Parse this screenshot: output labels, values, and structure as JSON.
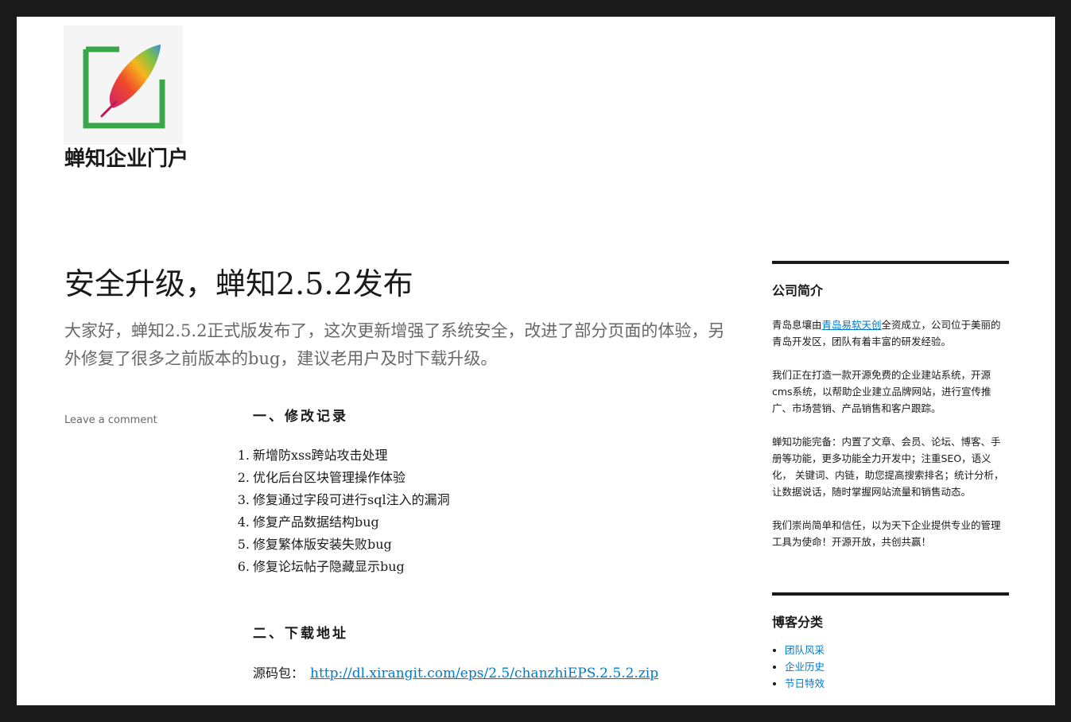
{
  "site": {
    "title": "蝉知企业门户",
    "logo_icon": "feather-logo-icon"
  },
  "post": {
    "title": "安全升级，蝉知2.5.2发布",
    "excerpt": "大家好，蝉知2.5.2正式版发布了，这次更新增强了系统安全，改进了部分页面的体验，另外修复了很多之前版本的bug，建议老用户及时下载升级。",
    "comment_link": "Leave a comment",
    "section1_heading": "一、修改记录",
    "changes": [
      {
        "num": "1.",
        "text": "新增防xss跨站攻击处理"
      },
      {
        "num": "2.",
        "text": "优化后台区块管理操作体验"
      },
      {
        "num": "3.",
        "text": "修复通过字段可进行sql注入的漏洞"
      },
      {
        "num": "4.",
        "text": "修复产品数据结构bug"
      },
      {
        "num": "5.",
        "text": "修复繁体版安装失败bug"
      },
      {
        "num": "6.",
        "text": "修复论坛帖子隐藏显示bug"
      }
    ],
    "section2_heading": "二、下载地址",
    "download_label": "源码包：",
    "download_url": "http://dl.xirangit.com/eps/2.5/chanzhiEPS.2.5.2.zip"
  },
  "sidebar": {
    "about": {
      "title": "公司简介",
      "p1_before": "青岛息壤由",
      "p1_link": "青岛易软天创",
      "p1_after": "全资成立，公司位于美丽的青岛开发区，团队有着丰富的研发经验。",
      "p2": "我们正在打造一款开源免费的企业建站系统，开源cms系统，以帮助企业建立品牌网站，进行宣传推广、市场营销、产品销售和客户跟踪。",
      "p3": "蝉知功能完备：内置了文章、会员、论坛、博客、手册等功能，更多功能全力开发中；注重SEO，语义化， 关键词、内链，助您提高搜索排名；统计分析，让数据说话，随时掌握网站流量和销售动态。",
      "p4": "我们崇尚简单和信任，以为天下企业提供专业的管理工具为使命！开源开放，共创共赢！"
    },
    "categories": {
      "title": "博客分类",
      "items": [
        "团队风采",
        "企业历史",
        "节日特效"
      ]
    }
  },
  "colors": {
    "link": "#007acc",
    "frame": "#1a1a1a",
    "muted": "#686868"
  }
}
